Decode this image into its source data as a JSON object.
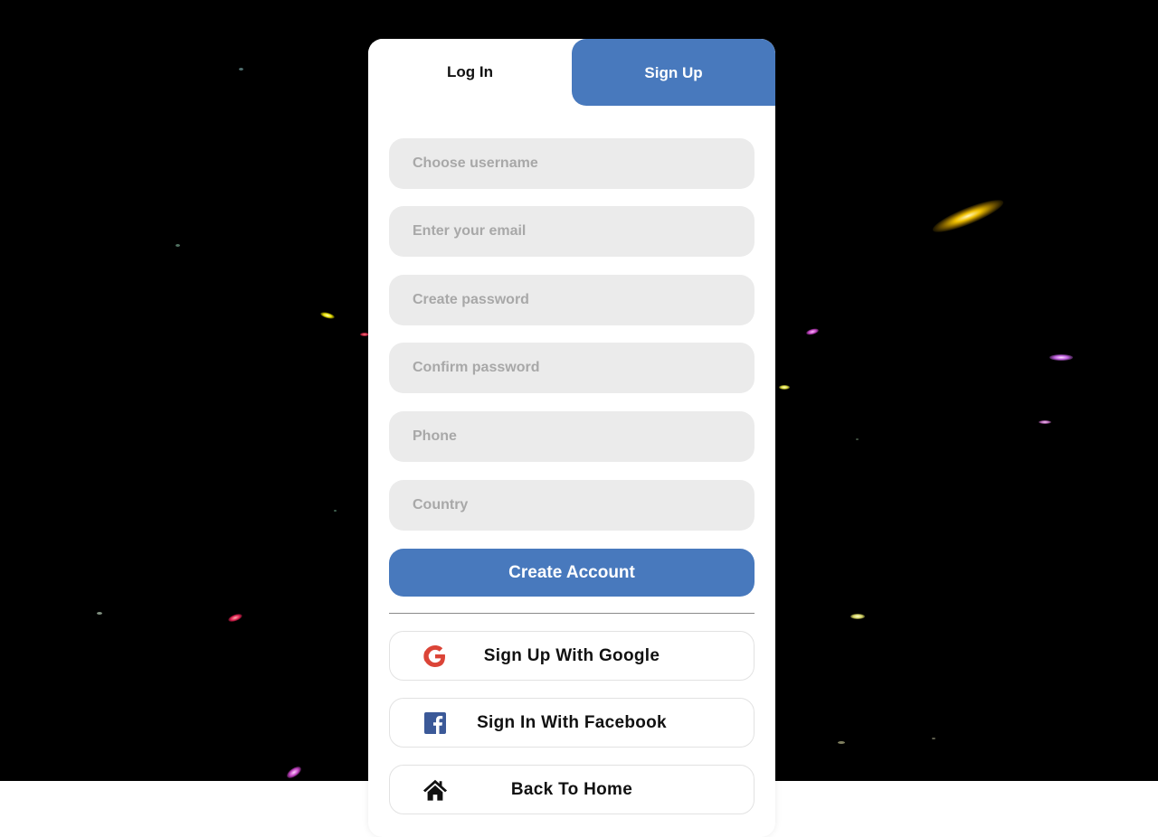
{
  "tabs": {
    "login_label": "Log In",
    "signup_label": "Sign Up"
  },
  "form": {
    "username_placeholder": "Choose username",
    "email_placeholder": "Enter your email",
    "password_placeholder": "Create password",
    "confirm_placeholder": "Confirm password",
    "phone_placeholder": "Phone",
    "country_placeholder": "Country",
    "submit_label": "Create Account"
  },
  "social": {
    "google_label": "Sign Up With Google",
    "facebook_label": "Sign In With Facebook",
    "home_label": "Back To Home"
  },
  "icons": {
    "google": "google-icon",
    "facebook": "facebook-icon",
    "home": "home-icon"
  },
  "colors": {
    "accent": "#4879bd",
    "field_bg": "#ebebeb",
    "background": "#000000",
    "google_red": "#db4437",
    "facebook_blue": "#3b5998"
  }
}
